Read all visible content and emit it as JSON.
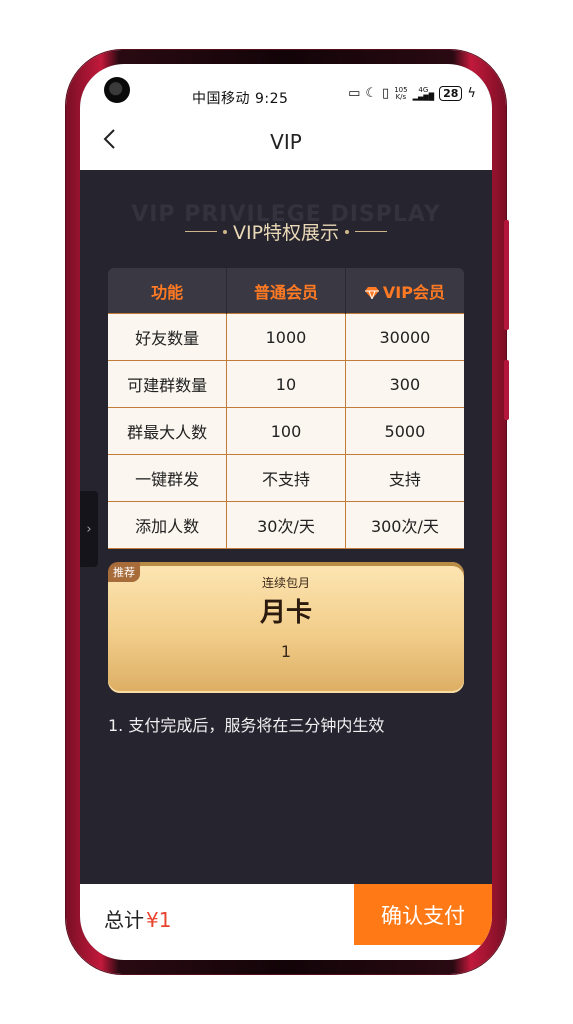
{
  "status_bar": {
    "carrier_time": "中国移动 9:25",
    "speed_top": "105",
    "speed_bottom": "K/s",
    "network": "4G",
    "battery": "28"
  },
  "header": {
    "title": "VIP"
  },
  "watermark": "VIP PRIVILEGE DISPLAY",
  "section_title": "VIP特权展示",
  "table": {
    "headers": [
      "功能",
      "普通会员",
      "VIP会员"
    ],
    "rows": [
      [
        "好友数量",
        "1000",
        "30000"
      ],
      [
        "可建群数量",
        "10",
        "300"
      ],
      [
        "群最大人数",
        "100",
        "5000"
      ],
      [
        "一键群发",
        "不支持",
        "支持"
      ],
      [
        "添加人数",
        "30次/天",
        "300次/天"
      ]
    ]
  },
  "plan": {
    "badge": "推荐",
    "subtitle": "连续包月",
    "name": "月卡",
    "price": "1"
  },
  "note": "1. 支付完成后，服务将在三分钟内生效",
  "footer": {
    "total_label": "总计",
    "price": "¥1",
    "pay_button": "确认支付"
  },
  "colors": {
    "accent": "#ff7a16",
    "price": "#e8442e",
    "background": "#26242f"
  }
}
